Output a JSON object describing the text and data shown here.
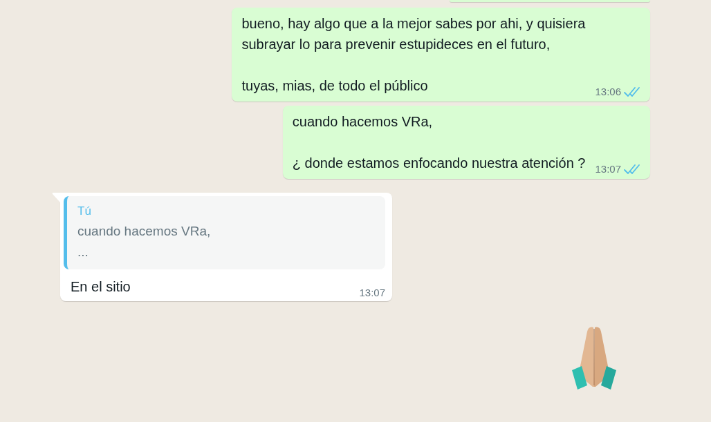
{
  "messages": [
    {
      "kind": "partial",
      "outgoing": true
    },
    {
      "kind": "text",
      "outgoing": true,
      "text": "bueno, hay algo que a la mejor sabes por ahi, y quisiera\nsubrayar lo para prevenir estupideces en el futuro,\n\ntuyas, mias, de todo el público",
      "time": "13:06",
      "read": true
    },
    {
      "kind": "text",
      "outgoing": true,
      "text": "cuando hacemos VRa,\n\n¿ donde estamos enfocando nuestra atención ?",
      "time": "13:07",
      "read": true
    },
    {
      "kind": "reply",
      "outgoing": false,
      "quote": {
        "author": "Tú",
        "text": "cuando hacemos VRa,\n..."
      },
      "text": "En el sitio",
      "time": "13:07"
    },
    {
      "kind": "emoji",
      "outgoing": true
    }
  ]
}
